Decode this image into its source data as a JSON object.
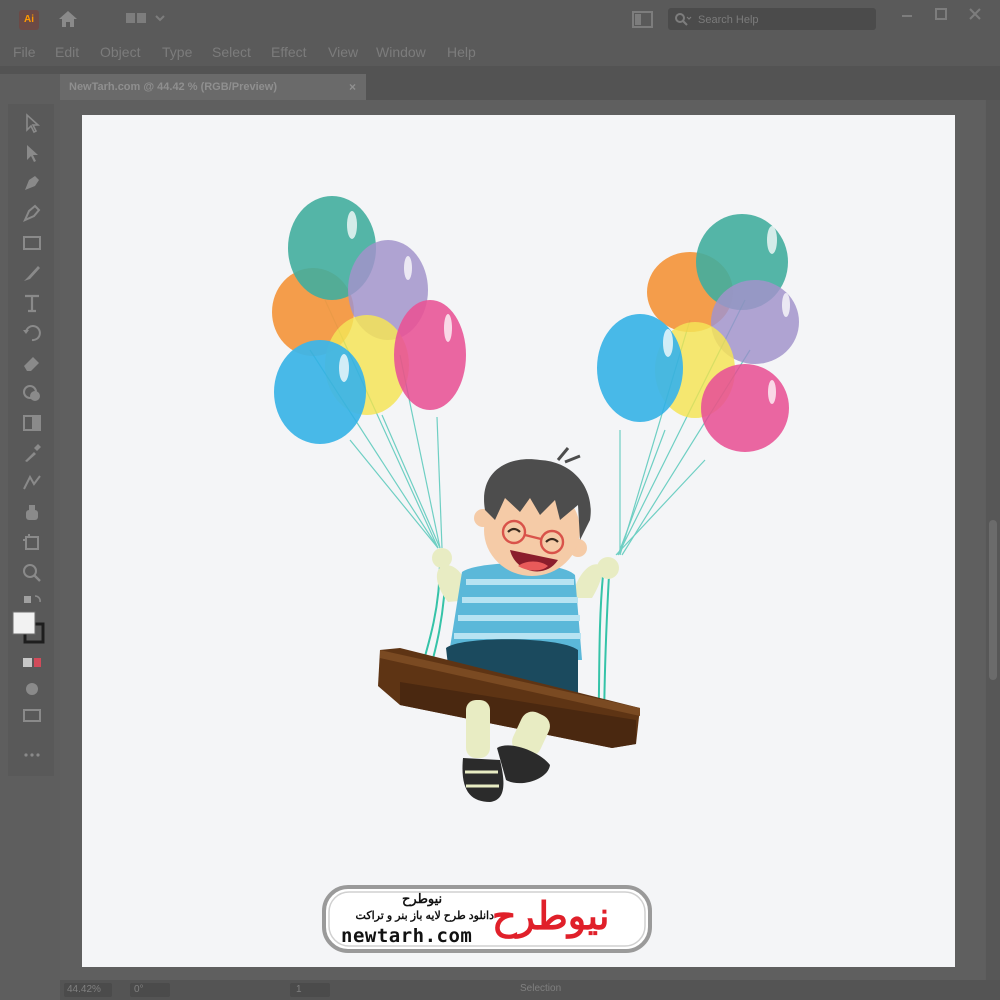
{
  "app": {
    "logo_label": "Ai"
  },
  "menu": {
    "items": [
      {
        "label": "File"
      },
      {
        "label": "Edit"
      },
      {
        "label": "Object"
      },
      {
        "label": "Type"
      },
      {
        "label": "Select"
      },
      {
        "label": "Effect"
      },
      {
        "label": "View"
      },
      {
        "label": "Window"
      },
      {
        "label": "Help"
      }
    ]
  },
  "search": {
    "placeholder": "Search Help"
  },
  "document": {
    "tab_title": "NewTarh.com @ 44.42 % (RGB/Preview)",
    "close_glyph": "×"
  },
  "status": {
    "zoom": "44.42%",
    "rotation": "0°",
    "artboard": "1",
    "tool": "Selection"
  },
  "watermark": {
    "brand_fa": "نیوطرح",
    "slogan_fa": "دانلود طرح لایه باز بنر و تراکت",
    "url": "newtarh.com",
    "logo_fa": "نیوطرح"
  },
  "colors": {
    "balloon_teal": "#33a797",
    "balloon_orange": "#f5963d",
    "balloon_purple": "#9b8cc8",
    "balloon_yellow": "#f5e34a",
    "balloon_pink": "#e8488f",
    "balloon_blue": "#2fb0e6",
    "swing_wood": "#6e3d16",
    "shirt_stripe": "#6dc4e3",
    "shorts": "#1b4a5e",
    "logo_red": "#e0202a"
  },
  "icons": [
    "home-icon",
    "workspace-switch-icon",
    "arrange-icon",
    "search-icon",
    "minimize-icon",
    "maximize-icon",
    "close-icon",
    "selection-tool-icon",
    "direct-selection-tool-icon",
    "pen-tool-icon",
    "curvature-tool-icon",
    "rectangle-tool-icon",
    "paintbrush-tool-icon",
    "type-tool-icon",
    "rotate-tool-icon",
    "eraser-tool-icon",
    "shape-builder-icon",
    "gradient-tool-icon",
    "eyedropper-tool-icon",
    "blend-tool-icon",
    "symbol-sprayer-icon",
    "artboard-tool-icon",
    "zoom-tool-icon",
    "swap-colors-icon",
    "fill-stroke-icon",
    "draw-mode-icon",
    "screen-mode-icon",
    "more-tools-icon"
  ]
}
